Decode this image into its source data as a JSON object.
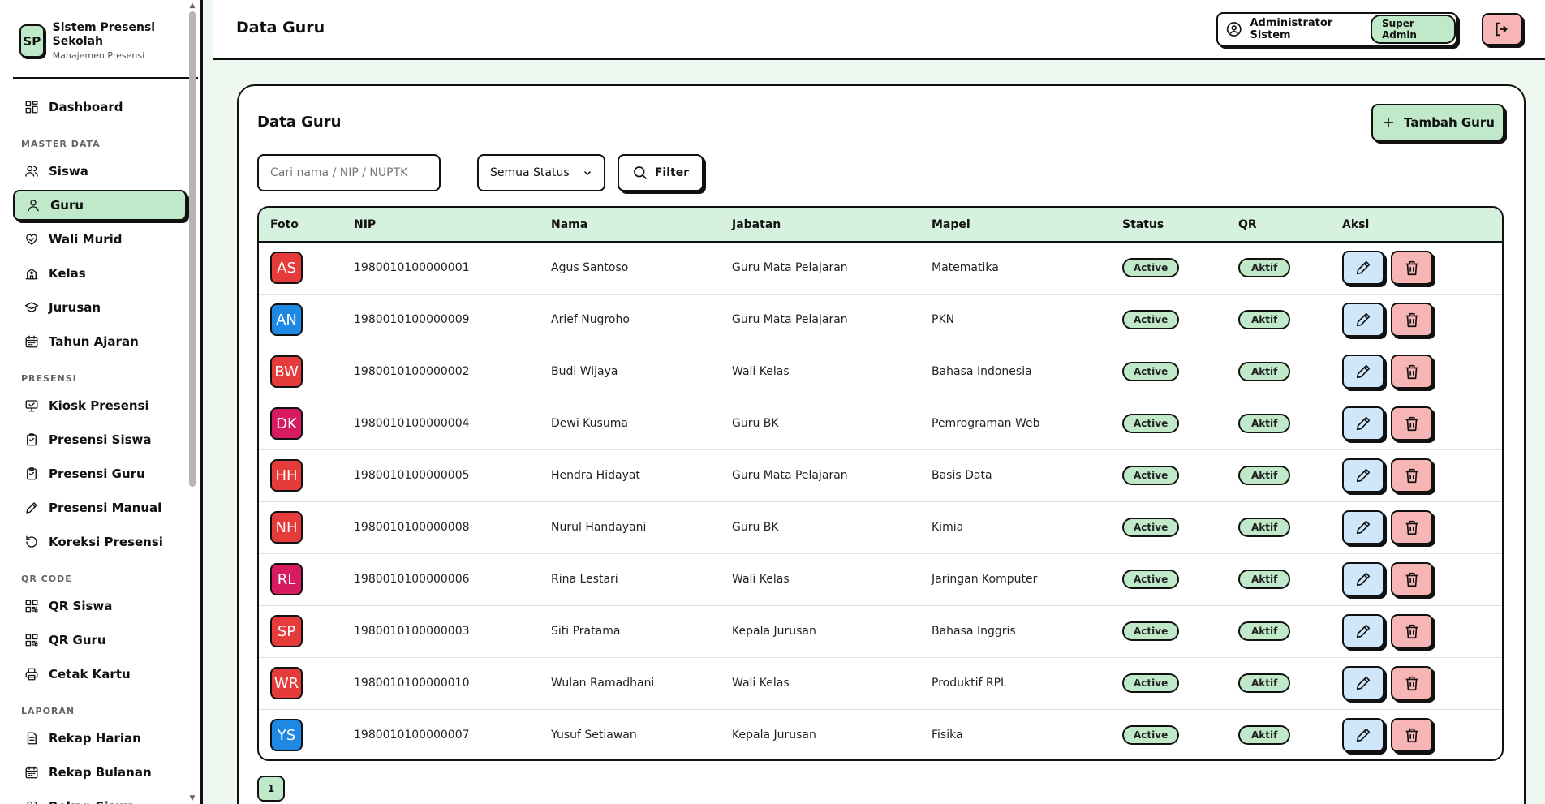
{
  "brand": {
    "logo": "SP",
    "title": "Sistem Presensi Sekolah",
    "subtitle": "Manajemen Presensi"
  },
  "sidebar": {
    "dashboard": "Dashboard",
    "sections": [
      {
        "label": "MASTER DATA",
        "items": [
          "Siswa",
          "Guru",
          "Wali Murid",
          "Kelas",
          "Jurusan",
          "Tahun Ajaran"
        ]
      },
      {
        "label": "PRESENSI",
        "items": [
          "Kiosk Presensi",
          "Presensi Siswa",
          "Presensi Guru",
          "Presensi Manual",
          "Koreksi Presensi"
        ]
      },
      {
        "label": "QR CODE",
        "items": [
          "QR Siswa",
          "QR Guru",
          "Cetak Kartu"
        ]
      },
      {
        "label": "LAPORAN",
        "items": [
          "Rekap Harian",
          "Rekap Bulanan",
          "Rekap Siswa"
        ]
      }
    ],
    "active": "Guru"
  },
  "header": {
    "title": "Data Guru",
    "user_name": "Administrator Sistem",
    "role": "Super Admin"
  },
  "card": {
    "title": "Data Guru",
    "add_label": "Tambah Guru",
    "search_placeholder": "Cari nama / NIP / NUPTK",
    "status_select": "Semua Status",
    "filter_label": "Filter"
  },
  "table": {
    "columns": [
      "Foto",
      "NIP",
      "Nama",
      "Jabatan",
      "Mapel",
      "Status",
      "QR",
      "Aksi"
    ],
    "rows": [
      {
        "initials": "AS",
        "color": "#e53b3b",
        "nip": "1980010100000001",
        "nama": "Agus Santoso",
        "jabatan": "Guru Mata Pelajaran",
        "mapel": "Matematika",
        "status": "Active",
        "qr": "Aktif"
      },
      {
        "initials": "AN",
        "color": "#1e88e5",
        "nip": "1980010100000009",
        "nama": "Arief Nugroho",
        "jabatan": "Guru Mata Pelajaran",
        "mapel": "PKN",
        "status": "Active",
        "qr": "Aktif"
      },
      {
        "initials": "BW",
        "color": "#e53b3b",
        "nip": "1980010100000002",
        "nama": "Budi Wijaya",
        "jabatan": "Wali Kelas",
        "mapel": "Bahasa Indonesia",
        "status": "Active",
        "qr": "Aktif"
      },
      {
        "initials": "DK",
        "color": "#d81b60",
        "nip": "1980010100000004",
        "nama": "Dewi Kusuma",
        "jabatan": "Guru BK",
        "mapel": "Pemrograman Web",
        "status": "Active",
        "qr": "Aktif"
      },
      {
        "initials": "HH",
        "color": "#e53b3b",
        "nip": "1980010100000005",
        "nama": "Hendra Hidayat",
        "jabatan": "Guru Mata Pelajaran",
        "mapel": "Basis Data",
        "status": "Active",
        "qr": "Aktif"
      },
      {
        "initials": "NH",
        "color": "#e53b3b",
        "nip": "1980010100000008",
        "nama": "Nurul Handayani",
        "jabatan": "Guru BK",
        "mapel": "Kimia",
        "status": "Active",
        "qr": "Aktif"
      },
      {
        "initials": "RL",
        "color": "#d81b60",
        "nip": "1980010100000006",
        "nama": "Rina Lestari",
        "jabatan": "Wali Kelas",
        "mapel": "Jaringan Komputer",
        "status": "Active",
        "qr": "Aktif"
      },
      {
        "initials": "SP",
        "color": "#e53b3b",
        "nip": "1980010100000003",
        "nama": "Siti Pratama",
        "jabatan": "Kepala Jurusan",
        "mapel": "Bahasa Inggris",
        "status": "Active",
        "qr": "Aktif"
      },
      {
        "initials": "WR",
        "color": "#e53b3b",
        "nip": "1980010100000010",
        "nama": "Wulan Ramadhani",
        "jabatan": "Wali Kelas",
        "mapel": "Produktif RPL",
        "status": "Active",
        "qr": "Aktif"
      },
      {
        "initials": "YS",
        "color": "#1e88e5",
        "nip": "1980010100000007",
        "nama": "Yusuf Setiawan",
        "jabatan": "Kepala Jurusan",
        "mapel": "Fisika",
        "status": "Active",
        "qr": "Aktif"
      }
    ]
  },
  "pagination": {
    "current": "1"
  },
  "colors": {
    "accent": "#bfe9c9",
    "danger": "#f7b5b5",
    "info": "#cfe6fb"
  },
  "icons": {
    "nav": [
      "dashboard-icon",
      "users-icon",
      "user-icon",
      "heart-hand-icon",
      "school-icon",
      "graduation-cap-icon",
      "calendar-icon",
      "monitor-icon",
      "clipboard-icon",
      "clipboard-icon",
      "pen-icon",
      "rotate-icon",
      "qr-icon",
      "qr-icon",
      "printer-icon",
      "file-icon",
      "calendar-icon",
      "users-icon"
    ]
  }
}
